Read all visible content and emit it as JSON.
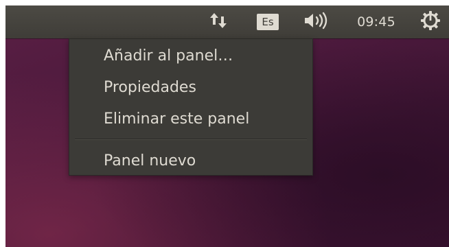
{
  "panel": {
    "indicators": [
      {
        "name": "network",
        "icon": "network-updown-icon"
      },
      {
        "name": "keyboard",
        "label": "Es"
      },
      {
        "name": "sound",
        "icon": "volume-icon"
      },
      {
        "name": "clock",
        "label": "09:45"
      },
      {
        "name": "session",
        "icon": "power-gear-icon"
      }
    ]
  },
  "menu": {
    "items": [
      {
        "label": "Añadir al panel…"
      },
      {
        "label": "Propiedades"
      },
      {
        "label": "Eliminar este panel"
      },
      {
        "label": "Panel nuevo"
      }
    ]
  },
  "colors": {
    "panel_bg": "#3f3d38",
    "menu_bg": "#3c3b37",
    "text": "#dfdbd2",
    "desktop": "#4d1a3d"
  }
}
